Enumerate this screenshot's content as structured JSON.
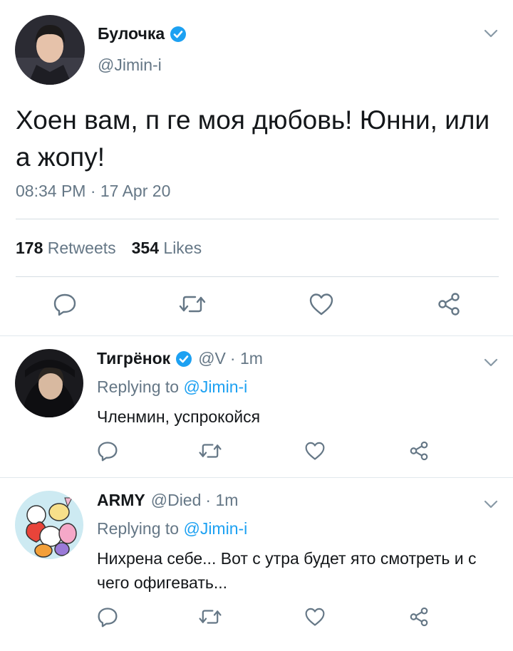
{
  "main_tweet": {
    "author_name": "Булочка",
    "handle": "@Jimin-i",
    "text": "Хоен вам, п ге моя дюбовь! Юнни, или а жопу!",
    "timestamp": "08:34 PM · 17 Apr 20",
    "retweets_count": "178",
    "retweets_label": "Retweets",
    "likes_count": "354",
    "likes_label": "Likes"
  },
  "replies": [
    {
      "author_name": "Тигрёнок",
      "verified": true,
      "handle": "@V",
      "time": "· 1m",
      "replying_label": "Replying to",
      "replying_handle": "@Jimin-i",
      "text": "Членмин, успрокойся"
    },
    {
      "author_name": "ARMY",
      "verified": false,
      "handle": "@Died",
      "time": "· 1m",
      "replying_label": "Replying to",
      "replying_handle": "@Jimin-i",
      "text": "Нихрена себе... Вот с утра будет ято смотреть и с чего офигевать..."
    }
  ],
  "icons": [
    "reply-icon",
    "retweet-icon",
    "like-icon",
    "share-icon",
    "chevron-down-icon",
    "verified-badge-icon"
  ],
  "colors": {
    "accent": "#1da1f2",
    "muted": "#657786",
    "text": "#14171a",
    "divider": "#e1e8ed"
  }
}
